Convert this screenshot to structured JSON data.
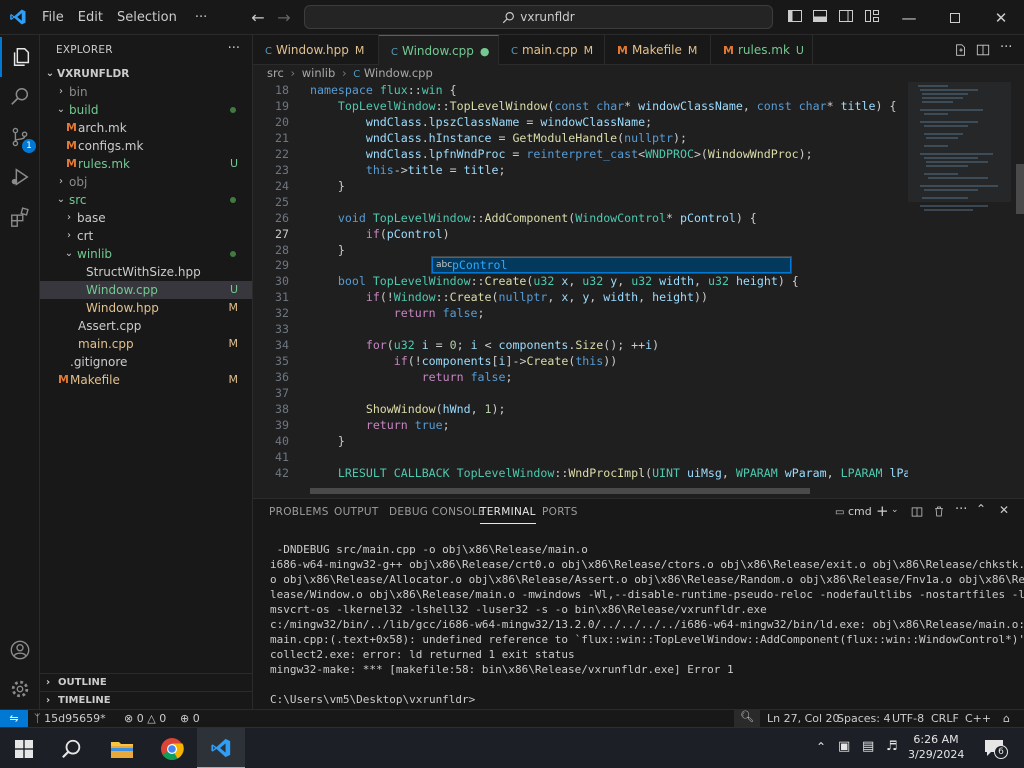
{
  "titlebar": {
    "menus": [
      "File",
      "Edit",
      "Selection",
      "···"
    ],
    "search": "vxrunfldr"
  },
  "explorer": {
    "title": "EXPLORER",
    "root": "VXRUNFLDR"
  },
  "tree": [
    {
      "name": "bin",
      "type": "folder",
      "open": false,
      "depth": 1,
      "color": "dim",
      "badge": ""
    },
    {
      "name": "build",
      "type": "folder",
      "open": true,
      "depth": 1,
      "color": "unt",
      "badge": "dot"
    },
    {
      "name": "arch.mk",
      "type": "mfile",
      "depth": 2,
      "color": "plain",
      "badge": ""
    },
    {
      "name": "configs.mk",
      "type": "mfile",
      "depth": 2,
      "color": "plain",
      "badge": ""
    },
    {
      "name": "rules.mk",
      "type": "mfile",
      "depth": 2,
      "color": "unt",
      "badge": "U"
    },
    {
      "name": "obj",
      "type": "folder",
      "open": false,
      "depth": 1,
      "color": "dim",
      "badge": ""
    },
    {
      "name": "src",
      "type": "folder",
      "open": true,
      "depth": 1,
      "color": "unt",
      "badge": "dot"
    },
    {
      "name": "base",
      "type": "folder",
      "open": false,
      "depth": 2,
      "color": "plain",
      "badge": ""
    },
    {
      "name": "crt",
      "type": "folder",
      "open": false,
      "depth": 2,
      "color": "plain",
      "badge": ""
    },
    {
      "name": "winlib",
      "type": "folder",
      "open": true,
      "depth": 2,
      "color": "unt",
      "badge": "dot"
    },
    {
      "name": "StructWithSize.hpp",
      "type": "file",
      "depth": 3,
      "color": "plain",
      "badge": ""
    },
    {
      "name": "Window.cpp",
      "type": "file",
      "depth": 3,
      "color": "unt",
      "badge": "U",
      "selected": true
    },
    {
      "name": "Window.hpp",
      "type": "file",
      "depth": 3,
      "color": "mod",
      "badge": "M"
    },
    {
      "name": "Assert.cpp",
      "type": "file",
      "depth": 2,
      "color": "plain",
      "badge": ""
    },
    {
      "name": "main.cpp",
      "type": "file",
      "depth": 2,
      "color": "mod",
      "badge": "M"
    },
    {
      "name": ".gitignore",
      "type": "file",
      "depth": 1,
      "color": "plain",
      "badge": ""
    },
    {
      "name": "Makefile",
      "type": "mfile",
      "depth": 1,
      "color": "mod",
      "badge": "M"
    }
  ],
  "tabs": [
    {
      "name": "Window.hpp",
      "badge": "M",
      "kind": "file",
      "color": "mod"
    },
    {
      "name": "Window.cpp",
      "badge": "●",
      "kind": "file",
      "color": "unt",
      "active": true
    },
    {
      "name": "main.cpp",
      "badge": "M",
      "kind": "file",
      "color": "mod"
    },
    {
      "name": "Makefile",
      "badge": "M",
      "kind": "mfile",
      "color": "mod"
    },
    {
      "name": "rules.mk",
      "badge": "U",
      "kind": "mfile",
      "color": "unt"
    }
  ],
  "breadcrumb": [
    "src",
    "winlib",
    "Window.cpp"
  ],
  "editor": {
    "lines": [
      {
        "n": "18",
        "html": "<span class='kw'>namespace</span> <span class='ty'>flux</span>::<span class='ty'>win</span> {"
      },
      {
        "n": "19",
        "html": "    <span class='ty'>TopLevelWindow</span>::<span class='fn'>TopLevelWindow</span>(<span class='kw'>const</span> <span class='kw'>char</span>* <span class='pa'>windowClassName</span>, <span class='kw'>const</span> <span class='kw'>char</span>* <span class='pa'>title</span>) {"
      },
      {
        "n": "20",
        "html": "        <span class='pa'>wndClass</span>.<span class='pa'>lpszClassName</span> = <span class='pa'>windowClassName</span>;"
      },
      {
        "n": "21",
        "html": "        <span class='pa'>wndClass</span>.<span class='pa'>hInstance</span> = <span class='fn'>GetModuleHandle</span>(<span class='kw'>nullptr</span>);"
      },
      {
        "n": "22",
        "html": "        <span class='pa'>wndClass</span>.<span class='pa'>lpfnWndProc</span> = <span class='kw'>reinterpret_cast</span>&lt;<span class='ty'>WNDPROC</span>&gt;(<span class='fn'>WindowWndProc</span>);"
      },
      {
        "n": "23",
        "html": "        <span class='kw'>this</span>-&gt;<span class='pa'>title</span> = <span class='pa'>title</span>;"
      },
      {
        "n": "24",
        "html": "    }"
      },
      {
        "n": "25",
        "html": ""
      },
      {
        "n": "26",
        "html": "    <span class='kw'>void</span> <span class='ty'>TopLevelWindow</span>::<span class='fn'>AddComponent</span>(<span class='ty'>WindowControl</span>* <span class='pa'>pControl</span>) {"
      },
      {
        "n": "27",
        "html": "        <span class='ctl'>if</span>(<span class='pa'>pControl</span>)",
        "current": true
      },
      {
        "n": "28",
        "html": "    }"
      },
      {
        "n": "29",
        "html": ""
      },
      {
        "n": "30",
        "html": "    <span class='kw'>bool</span> <span class='ty'>TopLevelWindow</span>::<span class='fn'>Create</span>(<span class='ty'>u32</span> <span class='pa'>x</span>, <span class='ty'>u32</span> <span class='pa'>y</span>, <span class='ty'>u32</span> <span class='pa'>width</span>, <span class='ty'>u32</span> <span class='pa'>height</span>) {"
      },
      {
        "n": "31",
        "html": "        <span class='ctl'>if</span>(!<span class='ty'>Window</span>::<span class='fn'>Create</span>(<span class='kw'>nullptr</span>, <span class='pa'>x</span>, <span class='pa'>y</span>, <span class='pa'>width</span>, <span class='pa'>height</span>))"
      },
      {
        "n": "32",
        "html": "            <span class='ctl'>return</span> <span class='kw'>false</span>;"
      },
      {
        "n": "33",
        "html": ""
      },
      {
        "n": "34",
        "html": "        <span class='ctl'>for</span>(<span class='ty'>u32</span> <span class='pa'>i</span> = <span class='nm2'>0</span>; <span class='pa'>i</span> &lt; <span class='pa'>components</span>.<span class='fn'>Size</span>(); ++<span class='pa'>i</span>)"
      },
      {
        "n": "35",
        "html": "            <span class='ctl'>if</span>(!<span class='pa'>components</span>[<span class='pa'>i</span>]-&gt;<span class='fn'>Create</span>(<span class='kw'>this</span>))"
      },
      {
        "n": "36",
        "html": "                <span class='ctl'>return</span> <span class='kw'>false</span>;"
      },
      {
        "n": "37",
        "html": ""
      },
      {
        "n": "38",
        "html": "        <span class='fn'>ShowWindow</span>(<span class='pa'>hWnd</span>, <span class='nm2'>1</span>);"
      },
      {
        "n": "39",
        "html": "        <span class='ctl'>return</span> <span class='kw'>true</span>;"
      },
      {
        "n": "40",
        "html": "    }"
      },
      {
        "n": "41",
        "html": ""
      },
      {
        "n": "42",
        "html": "    <span class='ty'>LRESULT</span> <span class='ty'>CALLBACK</span> <span class='ty'>TopLevelWindow</span>::<span class='fn'>WndProcImpl</span>(<span class='ty'>UINT</span> <span class='pa'>uiMsg</span>, <span class='ty'>WPARAM</span> <span class='pa'>wParam</span>, <span class='ty'>LPARAM</span> <span class='pa'>lParam</span>) {"
      }
    ],
    "suggestion": {
      "kind": "abc",
      "label": "pControl"
    }
  },
  "panel": {
    "tabs": [
      "PROBLEMS",
      "OUTPUT",
      "DEBUG CONSOLE",
      "TERMINAL",
      "PORTS"
    ],
    "active": "TERMINAL",
    "shell": "cmd",
    "terminal": [
      " -DNDEBUG src/main.cpp -o obj\\x86\\Release/main.o",
      "i686-w64-mingw32-g++ obj\\x86\\Release/crt0.o obj\\x86\\Release/ctors.o obj\\x86\\Release/exit.o obj\\x86\\Release/chkstk.",
      "o obj\\x86\\Release/Allocator.o obj\\x86\\Release/Assert.o obj\\x86\\Release/Random.o obj\\x86\\Release/Fnv1a.o obj\\x86\\Re",
      "lease/Window.o obj\\x86\\Release/main.o -mwindows -Wl,--disable-runtime-pseudo-reloc -nodefaultlibs -nostartfiles -l",
      "msvcrt-os -lkernel32 -lshell32 -luser32 -s -o bin\\x86\\Release/vxrunfldr.exe",
      "c:/mingw32/bin/../lib/gcc/i686-w64-mingw32/13.2.0/../../../../i686-w64-mingw32/bin/ld.exe: obj\\x86\\Release/main.o:",
      "main.cpp:(.text+0x58): undefined reference to `flux::win::TopLevelWindow::AddComponent(flux::win::WindowControl*)'",
      "collect2.exe: error: ld returned 1 exit status",
      "mingw32-make: *** [makefile:58: bin\\x86\\Release/vxrunfldr.exe] Error 1",
      "",
      "C:\\Users\\vm5\\Desktop\\vxrunfldr>"
    ]
  },
  "sections": {
    "outline": "OUTLINE",
    "timeline": "TIMELINE"
  },
  "status": {
    "branch": "15d95659*",
    "errors": "0",
    "warnings": "0",
    "ports": "0",
    "position": "Ln 27, Col 20",
    "spaces": "Spaces: 4",
    "encoding": "UTF-8",
    "eol": "CRLF",
    "language": "C++"
  },
  "taskbar": {
    "time": "6:26 AM",
    "date": "3/29/2024",
    "notifications": "6"
  }
}
